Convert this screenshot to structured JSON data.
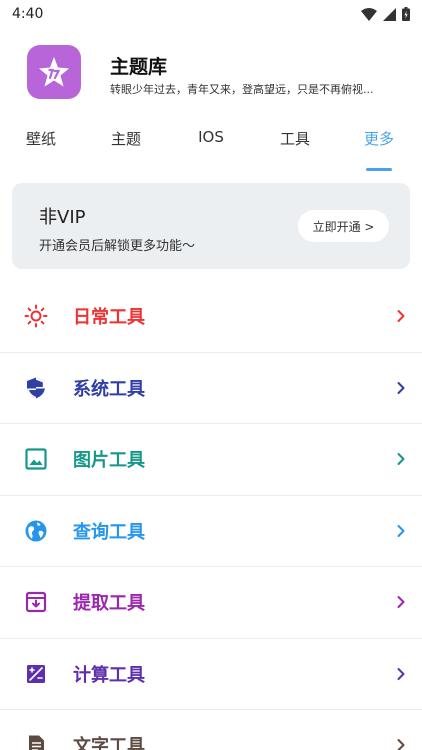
{
  "status_bar": {
    "time": "4:40"
  },
  "header": {
    "title": "主题库",
    "subtitle": "转眼少年过去，青年又来，登高望远，只是不再俯视...",
    "logo_icon": "star-icon",
    "logo_color": "#b765d8"
  },
  "tabs": [
    {
      "label": "壁纸"
    },
    {
      "label": "主题"
    },
    {
      "label": "IOS"
    },
    {
      "label": "工具"
    },
    {
      "label": "更多",
      "active": true
    }
  ],
  "vip": {
    "title": "非VIP",
    "description": "开通会员后解锁更多功能～",
    "button_label": "立即开通 >"
  },
  "tools": [
    {
      "label": "日常工具",
      "icon": "sun-icon",
      "color": "#ee3333"
    },
    {
      "label": "系统工具",
      "icon": "shield-icon",
      "color": "#2f3fa6"
    },
    {
      "label": "图片工具",
      "icon": "image-icon",
      "color": "#15978a"
    },
    {
      "label": "查询工具",
      "icon": "globe-icon",
      "color": "#2596ee"
    },
    {
      "label": "提取工具",
      "icon": "archive-icon",
      "color": "#9b27ae"
    },
    {
      "label": "计算工具",
      "icon": "calculator-icon",
      "color": "#5e2fac"
    },
    {
      "label": "文字工具",
      "icon": "document-icon",
      "color": "#5d4a42"
    }
  ]
}
